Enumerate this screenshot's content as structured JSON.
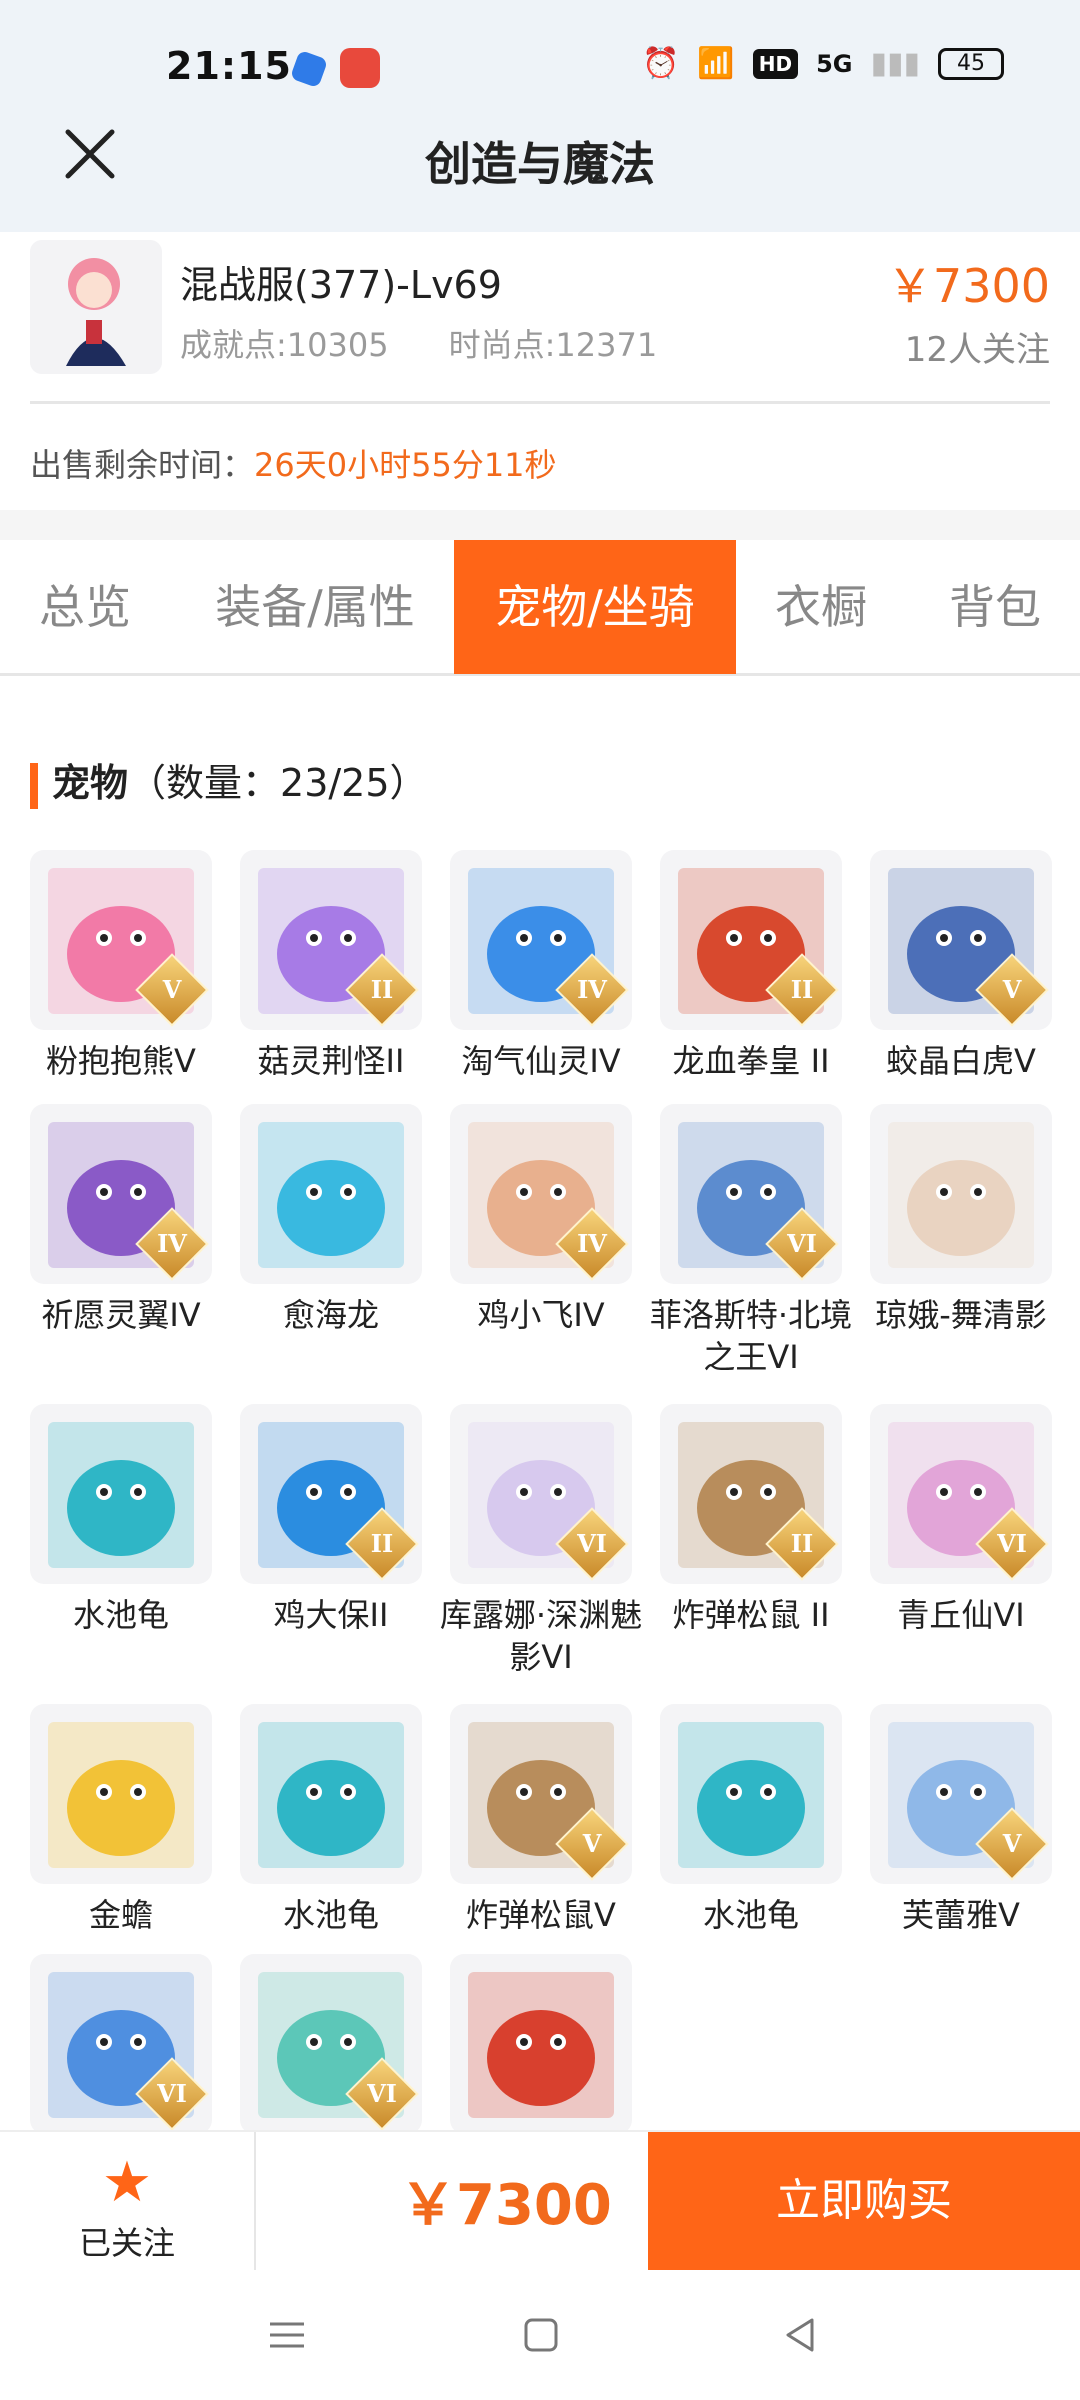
{
  "status": {
    "time": "21:15",
    "battery": "45",
    "network": "5G"
  },
  "header": {
    "title": "创造与魔法"
  },
  "product": {
    "name": "混战服(377)-Lv69",
    "achievement": "成就点:10305",
    "fashion": "时尚点:12371",
    "price": "￥7300",
    "followers": "12人关注"
  },
  "sale": {
    "label": "出售剩余时间：",
    "value": "26天0小时55分11秒"
  },
  "tabs": [
    {
      "label": "总览"
    },
    {
      "label": "装备/属性"
    },
    {
      "label": "宠物/坐骑",
      "active": true
    },
    {
      "label": "衣橱"
    },
    {
      "label": "背包"
    }
  ],
  "pets": {
    "section_title": "宠物",
    "count": "（数量：23/25）",
    "items": [
      {
        "name": "粉抱抱熊Ⅴ",
        "grade": "V",
        "color": "#f27aa7"
      },
      {
        "name": "菇灵荆怪II",
        "grade": "II",
        "color": "#a77be6"
      },
      {
        "name": "淘气仙灵IV",
        "grade": "IV",
        "color": "#3b8ee8"
      },
      {
        "name": "龙血拳皇 II",
        "grade": "II",
        "color": "#d8492e"
      },
      {
        "name": "蛟晶白虎Ⅴ",
        "grade": "V",
        "color": "#4c6fb8"
      },
      {
        "name": "祈愿灵翼IV",
        "grade": "IV",
        "color": "#8a5ac7"
      },
      {
        "name": "愈海龙",
        "grade": "",
        "color": "#39b9e0"
      },
      {
        "name": "鸡小飞IV",
        "grade": "IV",
        "color": "#e8b08e"
      },
      {
        "name": "菲洛斯特·北境之王VI",
        "grade": "VI",
        "color": "#5c8ccf"
      },
      {
        "name": "琼娥-舞清影",
        "grade": "",
        "color": "#e9d3c1"
      },
      {
        "name": "水池龟",
        "grade": "",
        "color": "#2fb6c6"
      },
      {
        "name": "鸡大保II",
        "grade": "II",
        "color": "#2b8de0"
      },
      {
        "name": "库露娜·深渊魅影VI",
        "grade": "VI",
        "color": "#d7c9ee"
      },
      {
        "name": "炸弹松鼠 II",
        "grade": "II",
        "color": "#b88d5c"
      },
      {
        "name": "青丘仙VI",
        "grade": "VI",
        "color": "#e2a5d8"
      },
      {
        "name": "金蟾",
        "grade": "",
        "color": "#f2c237"
      },
      {
        "name": "水池龟",
        "grade": "",
        "color": "#2fb6c6"
      },
      {
        "name": "炸弹松鼠Ⅴ",
        "grade": "V",
        "color": "#b88d5c"
      },
      {
        "name": "水池龟",
        "grade": "",
        "color": "#2fb6c6"
      },
      {
        "name": "芙蕾雅V",
        "grade": "V",
        "color": "#8fb8e8"
      },
      {
        "name": "",
        "grade": "VI",
        "color": "#4f8fe0"
      },
      {
        "name": "",
        "grade": "VI",
        "color": "#5cc7b8"
      },
      {
        "name": "",
        "grade": "",
        "color": "#d8402e"
      }
    ]
  },
  "bottom": {
    "follow_label": "已关注",
    "price": "￥7300",
    "buy_label": "立即购买"
  }
}
